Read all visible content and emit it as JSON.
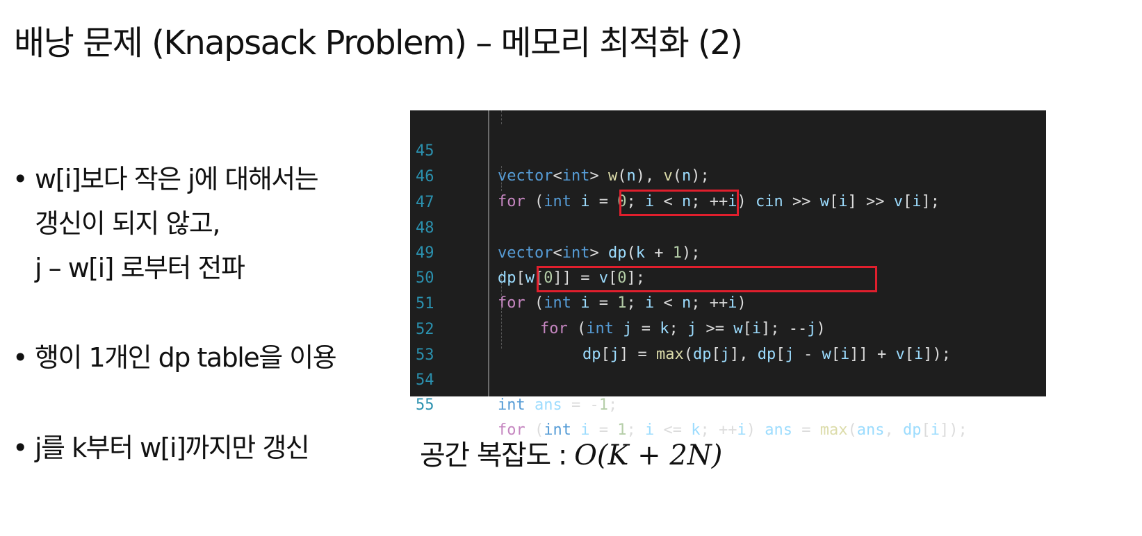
{
  "title": "배낭 문제 (Knapsack Problem) – 메모리 최적화 (2)",
  "bullets": [
    {
      "marker": "•",
      "lines": [
        "w[i]보다 작은 j에 대해서는",
        "갱신이 되지 않고,",
        "j – w[i] 로부터 전파"
      ]
    },
    {
      "marker": "•",
      "lines": [
        "행이 1개인 dp table을 이용"
      ]
    },
    {
      "marker": "•",
      "lines": [
        "j를 k부터 w[i]까지만 갱신"
      ]
    }
  ],
  "code": {
    "line_numbers": [
      "45",
      "46",
      "47",
      "48",
      "49",
      "50",
      "51",
      "52",
      "53",
      "54",
      "55"
    ],
    "lines": [
      "vector<int> w(n), v(n);",
      "for (int i = 0; i < n; ++i) cin >> w[i] >> v[i];",
      "",
      "vector<int> dp(k + 1);",
      "dp[w[0]] = v[0];",
      "for (int i = 1; i < n; ++i)",
      "for (int j = k; j >= w[i]; --j)",
      "dp[j] = max(dp[j], dp[j - w[i]] + v[i]);",
      "",
      "int ans = -1;",
      "for (int i = 1; i <= k; ++i) ans = max(ans, dp[i]);"
    ],
    "highlighted": [
      "dp(k + 1);",
      "for (int j = k; j >= w[i]; --j)"
    ],
    "colors": {
      "background": "#1e1e1e",
      "line_number": "#2b91af",
      "keyword": "#c586c0",
      "type": "#569cd6",
      "identifier": "#9cdcfe",
      "number": "#b5cea8",
      "function": "#dcdcaa",
      "highlight_border": "#e01f2d"
    }
  },
  "space_complexity": {
    "label": "공간 복잡도 :",
    "formula": "O(K + 2N)"
  }
}
